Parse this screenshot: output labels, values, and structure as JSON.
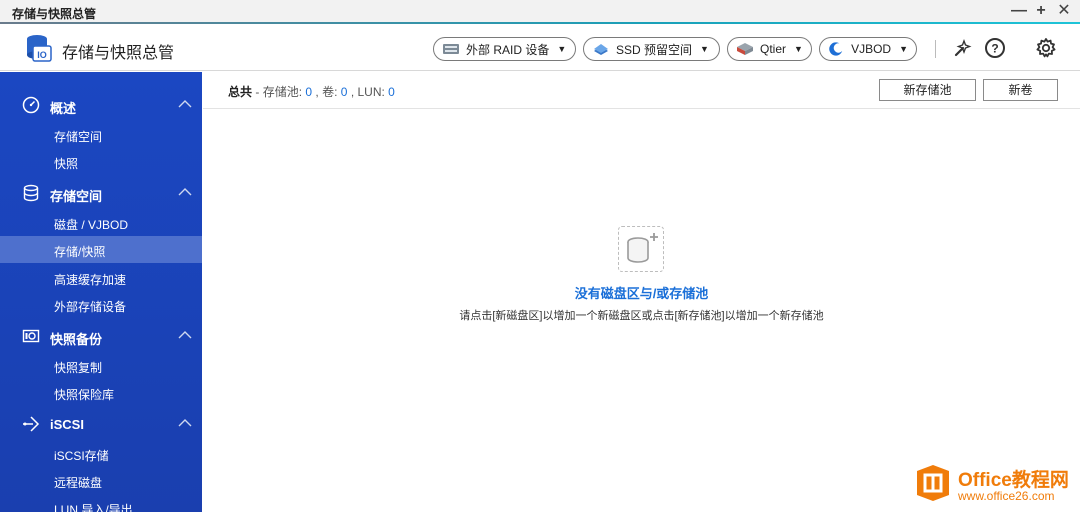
{
  "window": {
    "title": "存储与快照总管",
    "minimize": "—",
    "maximize": "+",
    "close": "✕"
  },
  "header": {
    "app_title": "存储与快照总管",
    "buttons": [
      {
        "label": "外部 RAID 设备",
        "icon": "raid-device-icon"
      },
      {
        "label": "SSD 预留空间",
        "icon": "ssd-icon"
      },
      {
        "label": "Qtier",
        "icon": "qtier-icon"
      },
      {
        "label": "VJBOD",
        "icon": "vjbod-icon"
      }
    ],
    "icons": [
      "diagnostics-icon",
      "help-icon",
      "gear-icon"
    ]
  },
  "sidebar": {
    "sections": [
      {
        "label": "概述",
        "icon": "dashboard-icon",
        "items": [
          "存储空间",
          "快照"
        ]
      },
      {
        "label": "存储空间",
        "icon": "database-icon",
        "items": [
          "磁盘 / VJBOD",
          "存储/快照",
          "高速缓存加速",
          "外部存储设备"
        ]
      },
      {
        "label": "快照备份",
        "icon": "snapshot-icon",
        "items": [
          "快照复制",
          "快照保险库"
        ]
      },
      {
        "label": "iSCSI",
        "icon": "iscsi-icon",
        "items": [
          "iSCSI存储",
          "远程磁盘",
          "LUN 导入/导出"
        ]
      }
    ],
    "active_item": "存储/快照"
  },
  "main": {
    "summary": {
      "label": "总共",
      "pool_label": "存储池:",
      "pool_count": "0",
      "volume_label": "卷:",
      "volume_count": "0",
      "lun_label": "LUN:",
      "lun_count": "0"
    },
    "buttons": {
      "new_pool": "新存储池",
      "new_volume": "新卷"
    },
    "empty_state": {
      "title": "没有磁盘区与/或存储池",
      "description": "请点击[新磁盘区]以增加一个新磁盘区或点击[新存储池]以增加一个新存储池"
    }
  },
  "watermark": {
    "name": "Office教程网",
    "url": "www.office26.com"
  },
  "colors": {
    "sidebar": "#1b47c2",
    "accent_link": "#1a6fd8",
    "watermark": "#f07c0a"
  }
}
